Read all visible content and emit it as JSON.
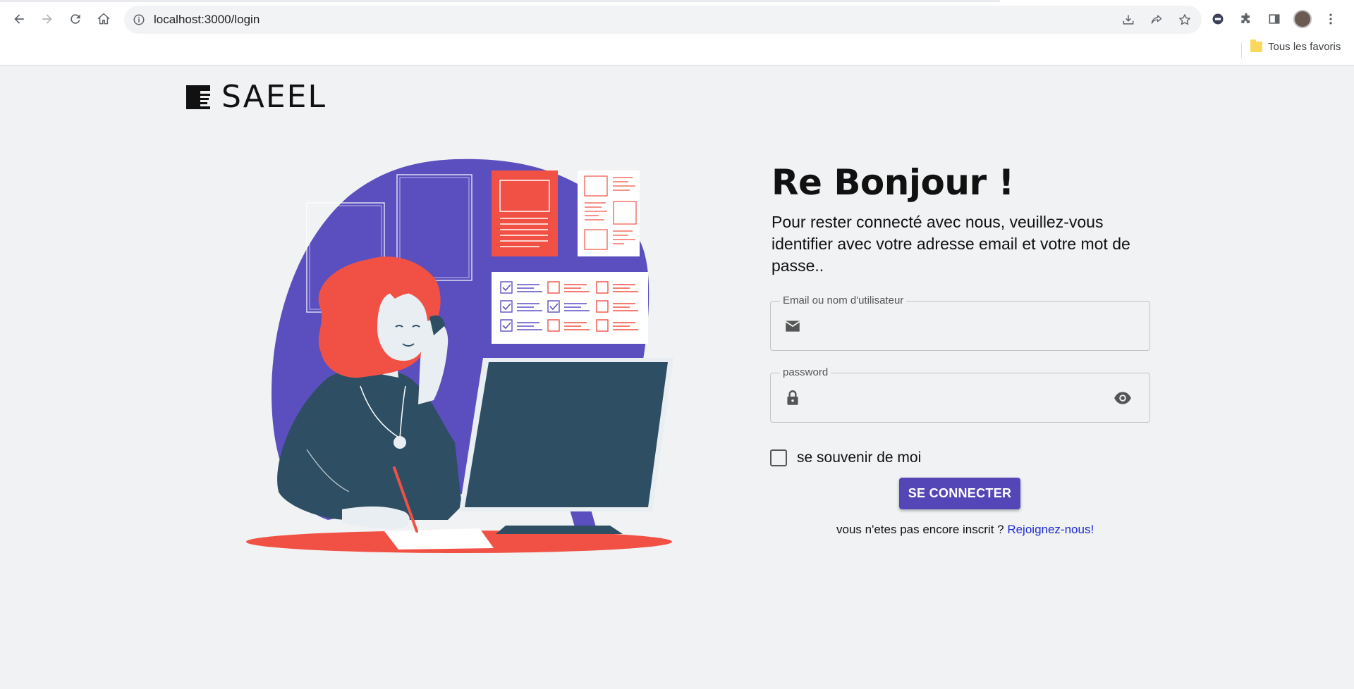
{
  "browser": {
    "url": "localhost:3000/login",
    "bookmark_folder": "Tous les favoris"
  },
  "brand": {
    "name": "SAEEL"
  },
  "login": {
    "title": "Re Bonjour !",
    "subtitle": "Pour rester connecté avec nous, veuillez-vous identifier avec votre adresse email et votre mot de passe..",
    "email_label": "Email ou nom d'utilisateur",
    "email_value": "",
    "password_label": "password",
    "password_value": "",
    "remember_label": "se souvenir de moi",
    "remember_checked": false,
    "submit_label": "SE CONNECTER",
    "signup_prompt": "vous n'etes pas encore inscrit ?",
    "signup_link": "Rejoignez-nous!"
  },
  "colors": {
    "accent": "#5546b8",
    "illustration_purple": "#5b4fbf",
    "illustration_red": "#f15144",
    "illustration_navy": "#2e4f63",
    "page_background": "#f0f2f3",
    "link": "#1f2bd1"
  },
  "icons": {
    "back": "arrow-left-icon",
    "forward": "arrow-right-icon",
    "reload": "reload-icon",
    "home": "home-icon",
    "site_info": "info-icon",
    "install": "install-icon",
    "share": "share-icon",
    "bookmark_star": "star-icon",
    "email_field": "envelope-icon",
    "password_field": "lock-icon",
    "show_password": "eye-icon"
  }
}
